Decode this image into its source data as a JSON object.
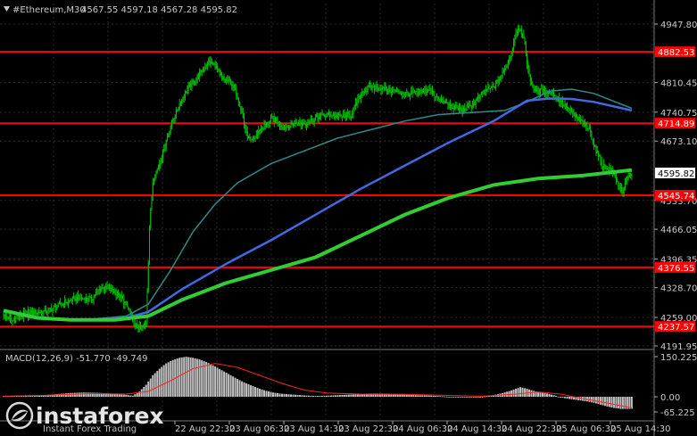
{
  "header": {
    "symbol": "#Ethereum,M30",
    "ohlc": "4567.55 4597.18 4567.28 4595.82"
  },
  "watermark": {
    "brand": "instaforex",
    "tagline": "Instant Forex Trading"
  },
  "colors": {
    "background": "#000000",
    "grid": "#2a2a2a",
    "candle": "#00c000",
    "level_line": "#ff0000",
    "ma_fast": "#2e8b8b",
    "ma_mid": "#4169e1",
    "ma_slow": "#32cd32",
    "macd_hist": "#c0c0c0",
    "macd_signal": "#ff2020",
    "text": "#c8c8c8"
  },
  "chart_data": [
    {
      "type": "candlestick",
      "title": "#Ethereum,M30",
      "ylim": [
        4191.95,
        4960
      ],
      "y_ticks": [
        "4947.80",
        "4810.45",
        "4740.75",
        "4673.10",
        "4533.70",
        "4466.05",
        "4396.35",
        "4328.70",
        "4259.00",
        "4191.95"
      ],
      "current_price": "4595.82",
      "levels": [
        "4882.53",
        "4714.89",
        "4545.74",
        "4376.55",
        "4237.57"
      ],
      "x_ticks": [
        "22 Aug 22:30",
        "23 Aug 06:30",
        "23 Aug 14:30",
        "23 Aug 22:30",
        "24 Aug 06:30",
        "24 Aug 14:30",
        "24 Aug 22:30",
        "25 Aug 06:30",
        "25 Aug 14:30"
      ],
      "close_path": [
        [
          0,
          4265
        ],
        [
          8,
          4250
        ],
        [
          20,
          4268
        ],
        [
          40,
          4275
        ],
        [
          52,
          4290
        ],
        [
          66,
          4305
        ],
        [
          78,
          4300
        ],
        [
          88,
          4330
        ],
        [
          100,
          4320
        ],
        [
          110,
          4290
        ],
        [
          118,
          4240
        ],
        [
          124,
          4228
        ],
        [
          128,
          4250
        ],
        [
          131,
          4470
        ],
        [
          134,
          4580
        ],
        [
          140,
          4620
        ],
        [
          150,
          4710
        ],
        [
          158,
          4760
        ],
        [
          166,
          4800
        ],
        [
          176,
          4830
        ],
        [
          184,
          4860
        ],
        [
          190,
          4850
        ],
        [
          196,
          4820
        ],
        [
          204,
          4810
        ],
        [
          210,
          4780
        ],
        [
          214,
          4740
        ],
        [
          218,
          4690
        ],
        [
          222,
          4670
        ],
        [
          232,
          4705
        ],
        [
          242,
          4725
        ],
        [
          252,
          4705
        ],
        [
          262,
          4715
        ],
        [
          272,
          4715
        ],
        [
          282,
          4730
        ],
        [
          292,
          4735
        ],
        [
          302,
          4730
        ],
        [
          312,
          4735
        ],
        [
          322,
          4790
        ],
        [
          332,
          4800
        ],
        [
          342,
          4795
        ],
        [
          352,
          4790
        ],
        [
          362,
          4785
        ],
        [
          372,
          4785
        ],
        [
          382,
          4795
        ],
        [
          392,
          4770
        ],
        [
          402,
          4755
        ],
        [
          412,
          4745
        ],
        [
          422,
          4760
        ],
        [
          432,
          4790
        ],
        [
          440,
          4800
        ],
        [
          448,
          4830
        ],
        [
          456,
          4880
        ],
        [
          460,
          4930
        ],
        [
          464,
          4940
        ],
        [
          468,
          4900
        ],
        [
          472,
          4820
        ],
        [
          478,
          4790
        ],
        [
          486,
          4790
        ],
        [
          494,
          4785
        ],
        [
          502,
          4760
        ],
        [
          510,
          4740
        ],
        [
          518,
          4720
        ],
        [
          526,
          4700
        ],
        [
          532,
          4650
        ],
        [
          538,
          4615
        ],
        [
          546,
          4605
        ],
        [
          552,
          4570
        ],
        [
          556,
          4555
        ],
        [
          560,
          4585
        ],
        [
          564,
          4595
        ]
      ],
      "ma_fast": [
        [
          0,
          4272
        ],
        [
          40,
          4255
        ],
        [
          80,
          4255
        ],
        [
          110,
          4262
        ],
        [
          130,
          4290
        ],
        [
          150,
          4370
        ],
        [
          170,
          4460
        ],
        [
          190,
          4525
        ],
        [
          210,
          4575
        ],
        [
          240,
          4620
        ],
        [
          270,
          4650
        ],
        [
          300,
          4680
        ],
        [
          330,
          4700
        ],
        [
          360,
          4720
        ],
        [
          390,
          4735
        ],
        [
          420,
          4740
        ],
        [
          450,
          4745
        ],
        [
          470,
          4765
        ],
        [
          490,
          4790
        ],
        [
          510,
          4795
        ],
        [
          530,
          4785
        ],
        [
          564,
          4750
        ]
      ],
      "ma_mid": [
        [
          0,
          4275
        ],
        [
          40,
          4255
        ],
        [
          80,
          4252
        ],
        [
          110,
          4258
        ],
        [
          130,
          4272
        ],
        [
          160,
          4325
        ],
        [
          200,
          4385
        ],
        [
          240,
          4440
        ],
        [
          280,
          4500
        ],
        [
          320,
          4560
        ],
        [
          360,
          4615
        ],
        [
          400,
          4670
        ],
        [
          440,
          4720
        ],
        [
          470,
          4768
        ],
        [
          490,
          4773
        ],
        [
          510,
          4772
        ],
        [
          530,
          4765
        ],
        [
          564,
          4745
        ]
      ],
      "ma_slow": [
        [
          0,
          4275
        ],
        [
          30,
          4258
        ],
        [
          60,
          4253
        ],
        [
          100,
          4253
        ],
        [
          130,
          4262
        ],
        [
          160,
          4300
        ],
        [
          200,
          4340
        ],
        [
          240,
          4370
        ],
        [
          280,
          4400
        ],
        [
          320,
          4450
        ],
        [
          360,
          4500
        ],
        [
          400,
          4540
        ],
        [
          440,
          4570
        ],
        [
          480,
          4585
        ],
        [
          520,
          4592
        ],
        [
          564,
          4605
        ]
      ]
    },
    {
      "type": "bar",
      "title": "MACD(12,26,9) -51.770 -49.749",
      "ylim": [
        -80,
        165
      ],
      "y_ticks": [
        "150.225",
        "0.00",
        "-65.225"
      ],
      "histogram": [
        [
          0,
          2
        ],
        [
          12,
          3
        ],
        [
          24,
          4
        ],
        [
          36,
          6
        ],
        [
          48,
          10
        ],
        [
          60,
          14
        ],
        [
          72,
          16
        ],
        [
          84,
          15
        ],
        [
          96,
          12
        ],
        [
          108,
          8
        ],
        [
          116,
          4
        ],
        [
          122,
          20
        ],
        [
          128,
          45
        ],
        [
          134,
          80
        ],
        [
          140,
          105
        ],
        [
          146,
          125
        ],
        [
          152,
          138
        ],
        [
          158,
          146
        ],
        [
          164,
          150
        ],
        [
          170,
          146
        ],
        [
          176,
          140
        ],
        [
          182,
          130
        ],
        [
          188,
          118
        ],
        [
          194,
          104
        ],
        [
          200,
          90
        ],
        [
          206,
          76
        ],
        [
          212,
          62
        ],
        [
          218,
          50
        ],
        [
          224,
          40
        ],
        [
          230,
          30
        ],
        [
          236,
          22
        ],
        [
          242,
          16
        ],
        [
          248,
          12
        ],
        [
          254,
          10
        ],
        [
          260,
          8
        ],
        [
          270,
          5
        ],
        [
          280,
          3
        ],
        [
          290,
          4
        ],
        [
          300,
          6
        ],
        [
          310,
          8
        ],
        [
          320,
          10
        ],
        [
          330,
          12
        ],
        [
          340,
          12
        ],
        [
          350,
          10
        ],
        [
          360,
          8
        ],
        [
          370,
          6
        ],
        [
          380,
          5
        ],
        [
          390,
          3
        ],
        [
          400,
          0
        ],
        [
          410,
          -2
        ],
        [
          420,
          -3
        ],
        [
          430,
          0
        ],
        [
          440,
          6
        ],
        [
          448,
          14
        ],
        [
          456,
          24
        ],
        [
          464,
          36
        ],
        [
          470,
          30
        ],
        [
          476,
          22
        ],
        [
          482,
          16
        ],
        [
          488,
          12
        ],
        [
          494,
          6
        ],
        [
          500,
          -2
        ],
        [
          506,
          -8
        ],
        [
          512,
          -12
        ],
        [
          518,
          -16
        ],
        [
          524,
          -20
        ],
        [
          530,
          -26
        ],
        [
          536,
          -34
        ],
        [
          542,
          -42
        ],
        [
          548,
          -48
        ],
        [
          554,
          -52
        ],
        [
          560,
          -52
        ],
        [
          564,
          -52
        ]
      ],
      "signal": [
        [
          0,
          2
        ],
        [
          40,
          6
        ],
        [
          80,
          12
        ],
        [
          110,
          10
        ],
        [
          130,
          20
        ],
        [
          150,
          60
        ],
        [
          170,
          105
        ],
        [
          190,
          125
        ],
        [
          210,
          110
        ],
        [
          230,
          80
        ],
        [
          250,
          50
        ],
        [
          270,
          25
        ],
        [
          290,
          14
        ],
        [
          320,
          10
        ],
        [
          360,
          9
        ],
        [
          400,
          5
        ],
        [
          430,
          2
        ],
        [
          460,
          10
        ],
        [
          480,
          18
        ],
        [
          500,
          10
        ],
        [
          520,
          -8
        ],
        [
          540,
          -25
        ],
        [
          564,
          -48
        ]
      ]
    }
  ]
}
